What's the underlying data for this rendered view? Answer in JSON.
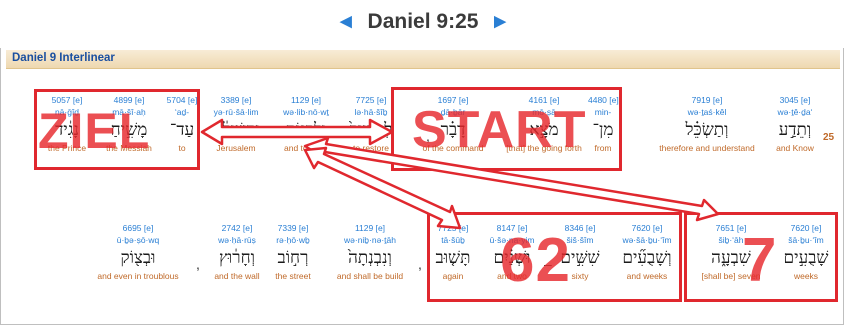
{
  "nav": {
    "prev_icon": "◀",
    "next_icon": "▶",
    "reference": "Daniel 9:25"
  },
  "section_header": "Daniel 9 Interlinear",
  "verse_number": "25",
  "row1": [
    {
      "num": "3045 [e]",
      "tr": "wə·ṯê·ḏa‘",
      "heb": "וְתֵדַ֣ע",
      "en": "and Know"
    },
    {
      "num": "7919 [e]",
      "tr": "wə·ṯaś·kêl",
      "heb": "וְתַשְׂכֵּ֗ל",
      "en": "therefore and understand"
    },
    {
      "num": "4480 [e]",
      "tr": "min-",
      "heb": "מִן־",
      "en": "from"
    },
    {
      "num": "4161 [e]",
      "tr": "mō·ṣā",
      "heb": "מֹצָ֣א",
      "en": "[that] the going forth"
    },
    {
      "num": "1697 [e]",
      "tr": "ḏā·ḇār",
      "heb": "דָבָ֗ר",
      "en": "of the command"
    },
    {
      "num": "7725 [e]",
      "tr": "lə·hā·šîḇ",
      "heb": "לְהָשִׁיב֙",
      "en": "to restore"
    },
    {
      "num": "1129 [e]",
      "tr": "wə·lib·nō·wṯ",
      "heb": "וְלִבְנ֣וֹת",
      "en": "and to build"
    },
    {
      "num": "3389 [e]",
      "tr": "yə·rū·šā·lim",
      "heb": "יְרוּשָׁלִַ֔ם",
      "en": "Jerusalem"
    },
    {
      "num": "5704 [e]",
      "tr": "‘aḏ-",
      "heb": "עַד־",
      "en": "to"
    },
    {
      "num": "4899 [e]",
      "tr": "mā·šî·aḥ",
      "heb": "מָשִׁ֣יחַ",
      "en": "the Messiah"
    },
    {
      "num": "5057 [e]",
      "tr": "nā·ḡîḏ",
      "heb": "נָגִ֔יד",
      "en": "the Prince"
    }
  ],
  "row2": [
    {
      "num": "7620 [e]",
      "tr": "šā·ḇu·‘îm",
      "heb": "שָׁבֻעִ֣ים",
      "en": "weeks"
    },
    {
      "num": "7651 [e]",
      "tr": "šiḇ·‘āh",
      "heb": "שִׁבְעָ֑ה",
      "en": "[shall be] seven"
    },
    {
      "num": "7620 [e]",
      "tr": "wə·šā·ḇu·‘îm",
      "heb": "וְשָׁבֻעִ֞ים",
      "en": "and weeks"
    },
    {
      "num": "8346 [e]",
      "tr": "šiš·šîm",
      "heb": "שִׁשִּׁ֣ים",
      "en": "sixty"
    },
    {
      "num": "8147 [e]",
      "tr": "ū·šə·na·yim",
      "heb": "וּשְׁנַ֗יִם",
      "en": "and two"
    },
    {
      "num": "7725 [e]",
      "tr": "tā·šūḇ",
      "heb": "תָּשׁ֤וּב",
      "en": "again"
    },
    {
      "num": "1129 [e]",
      "tr": "wə·niḇ·nə·ṯāh",
      "heb": "וְנִבְנְתָה֙",
      "en": "and shall be build"
    },
    {
      "num": "7339 [e]",
      "tr": "rə·ḥō·wḇ",
      "heb": "רְח֣וֹב",
      "en": "the street"
    },
    {
      "num": "2742 [e]",
      "tr": "wə·ḥā·rūṣ",
      "heb": "וְחָר֔וּץ",
      "en": "and the wall"
    },
    {
      "num": "6695 [e]",
      "tr": "ū·ḇə·ṣō·wq",
      "heb": "וּבְצ֖וֹק",
      "en": "and even in troublous"
    }
  ],
  "annotations": {
    "label_ziel": "ZIEL",
    "label_start": "START",
    "label_62": "62",
    "label_7": "7",
    "color": "#e0282e"
  }
}
